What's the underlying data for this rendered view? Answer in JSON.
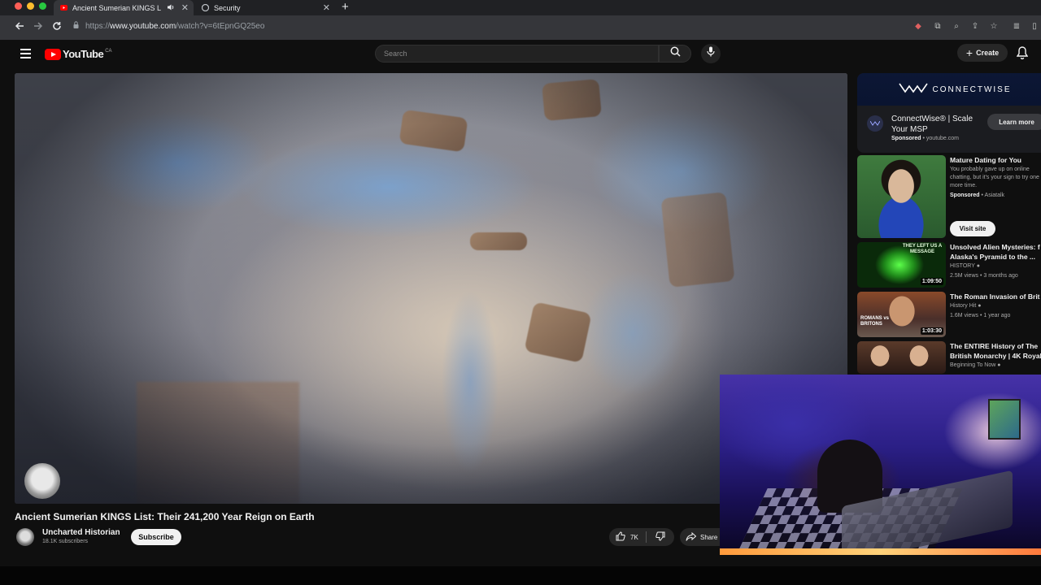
{
  "browser": {
    "tabs": [
      {
        "title": "Ancient Sumerian KINGS L",
        "close": "✕"
      },
      {
        "title": "Security",
        "close": "✕"
      }
    ],
    "new_tab": "+",
    "url_scheme": "https://",
    "url_host": "www.youtube.com",
    "url_path": "/watch?v=6tEpnGQ25eo"
  },
  "youtube": {
    "logo_text": "YouTube",
    "country_code": "CA",
    "search_placeholder": "Search",
    "create_label": "Create"
  },
  "video": {
    "title": "Ancient Sumerian KINGS List: Their 241,200 Year Reign on Earth",
    "channel": "Uncharted Historian",
    "subscribers": "18.1K subscribers",
    "subscribe_label": "Subscribe",
    "likes": "7K",
    "share_label": "Share"
  },
  "sidebar": {
    "ad": {
      "brand": "CONNECTWISE",
      "title": "ConnectWise® | Scale Your MSP",
      "sponsored": "Sponsored",
      "domain": "youtube.com",
      "cta": "Learn more"
    },
    "items": [
      {
        "title": "Mature Dating for You",
        "desc": "You probably gave up on online chatting, but it's your sign to try one more time.",
        "sponsored": "Sponsored",
        "advertiser": "Asiatalk",
        "cta": "Visit site"
      },
      {
        "title": "Unsolved Alien Mysteries: f Alaska's Pyramid to the ...",
        "channel": "HISTORY",
        "meta": "2.5M views • 3 months ago",
        "duration": "1:09:50",
        "thumb_text": "THEY LEFT US A MESSAGE"
      },
      {
        "title": "The Roman Invasion of Brit",
        "channel": "History Hit",
        "meta": "1.6M views • 1 year ago",
        "duration": "1:03:30",
        "thumb_text": "ROMANS vs BRITONS"
      },
      {
        "title": "The ENTIRE History of The British Monarchy | 4K Royal",
        "channel": "Beginning To Now",
        "meta": ""
      }
    ]
  },
  "colors": {
    "accent": "#ff0000",
    "background": "#0f0f0f",
    "chip": "#272727"
  }
}
